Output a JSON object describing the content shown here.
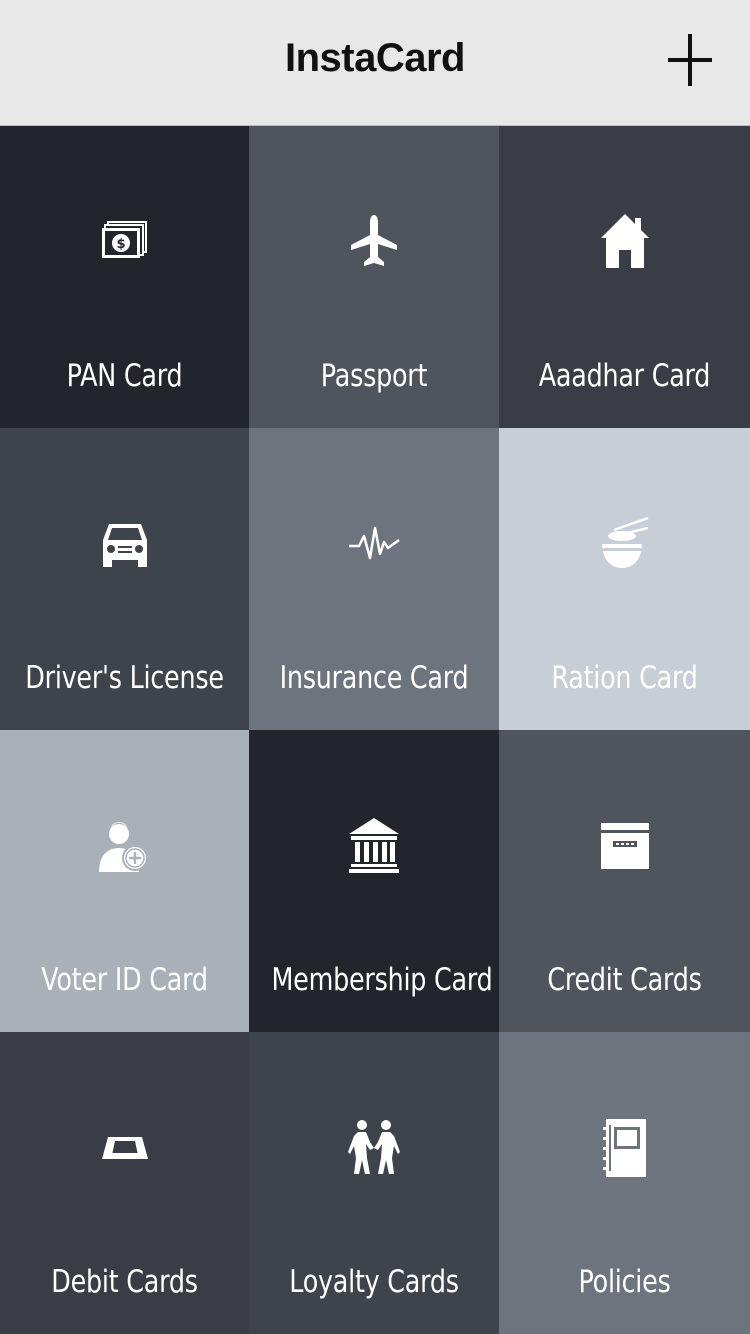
{
  "header": {
    "title": "InstaCard",
    "add_button": "plus-icon"
  },
  "tiles": [
    {
      "label": "PAN Card",
      "icon": "money-bill-icon",
      "color": "#22252c"
    },
    {
      "label": "Passport",
      "icon": "airplane-icon",
      "color": "#50545d"
    },
    {
      "label": "Aaadhar Card",
      "icon": "house-icon",
      "color": "#3a3d45"
    },
    {
      "label": "Driver's License",
      "icon": "car-icon",
      "color": "#3f434b"
    },
    {
      "label": "Insurance Card",
      "icon": "heartbeat-icon",
      "color": "#6e747e"
    },
    {
      "label": "Ration Card",
      "icon": "food-bowl-icon",
      "color": "#c8ced6"
    },
    {
      "label": "Voter ID Card",
      "icon": "add-user-icon",
      "color": "#aab0b8"
    },
    {
      "label": "Membership Card",
      "icon": "institution-icon",
      "color": "#22252c"
    },
    {
      "label": "Credit Cards",
      "icon": "credit-card-icon",
      "color": "#50545d"
    },
    {
      "label": "Debit Cards",
      "icon": "card-slot-icon",
      "color": "#3a3d45"
    },
    {
      "label": "Loyalty Cards",
      "icon": "people-icon",
      "color": "#3f434b"
    },
    {
      "label": "Policies",
      "icon": "notebook-icon",
      "color": "#6e747e"
    }
  ]
}
